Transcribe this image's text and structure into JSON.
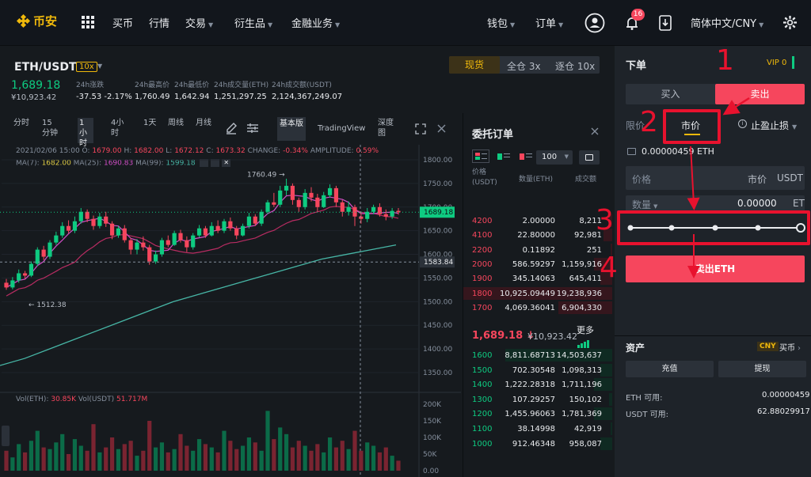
{
  "nav": {
    "brand": "币安",
    "buy": "买币",
    "market": "行情",
    "trade": "交易",
    "derivatives": "衍生品",
    "finance": "金融业务",
    "wallet": "钱包",
    "orders": "订单",
    "notif_count": "16",
    "lang": "简体中文/CNY"
  },
  "ticker": {
    "pair": "ETH/USDT",
    "leverage": "10x",
    "price": "1,689.18",
    "fiat": "¥10,923.42",
    "stats": [
      {
        "label": "24h涨跌",
        "value": "-37.53 -2.17%"
      },
      {
        "label": "24h最高价",
        "value": "1,760.49"
      },
      {
        "label": "24h最低价",
        "value": "1,642.94"
      },
      {
        "label": "24h成交量(ETH)",
        "value": "1,251,297.25"
      },
      {
        "label": "24h成交额(USDT)",
        "value": "2,124,367,249.07"
      }
    ],
    "mode_spot": "现货",
    "mode_cross": "全仓",
    "cross_lev": "3x",
    "mode_iso": "逐仓",
    "iso_lev": "10x"
  },
  "chart": {
    "intervals": [
      "分时",
      "15分钟",
      "1小时",
      "4小时",
      "1天",
      "周线",
      "月线"
    ],
    "basic": "基本版",
    "tv": "TradingView",
    "depth": "深度图",
    "info": "2021/02/06 15:00",
    "o_l": "O:",
    "o": "1679.00",
    "h_l": "H:",
    "h": "1682.00",
    "l_l": "L:",
    "l": "1672.12",
    "c_l": "C:",
    "c": "1673.32",
    "chg_l": "CHANGE:",
    "chg": "-0.34%",
    "amp_l": "AMPLITUDE:",
    "amp": "0.59%",
    "ma7_l": "MA(7):",
    "ma7": "1682.00",
    "ma25_l": "MA(25):",
    "ma25": "1690.83",
    "ma99_l": "MA(99):",
    "ma99": "1599.18",
    "high_mark": "1760.49",
    "low_mark": "1512.38",
    "price_tag": "1689.18",
    "cross_tag": "1583.84",
    "vol_eth_l": "Vol(ETH):",
    "vol_eth": "30.85K",
    "vol_usdt_l": "Vol(USDT)",
    "vol_usdt": "51.717M",
    "yticks": [
      "1800.00",
      "1750.00",
      "1700.00",
      "1650.00",
      "1600.00",
      "1550.00",
      "1500.00",
      "1450.00",
      "1400.00",
      "1350.00"
    ],
    "vticks": [
      "200K",
      "150K",
      "100K",
      "50K",
      "0.00"
    ]
  },
  "chart_data": {
    "type": "candlestick",
    "pair": "ETH/USDT",
    "candles": [
      [
        1540,
        1530,
        1548,
        1525
      ],
      [
        1530,
        1545,
        1552,
        1526
      ],
      [
        1545,
        1560,
        1568,
        1540
      ],
      [
        1560,
        1555,
        1565,
        1548
      ],
      [
        1555,
        1580,
        1585,
        1552
      ],
      [
        1580,
        1610,
        1615,
        1575
      ],
      [
        1610,
        1595,
        1618,
        1588
      ],
      [
        1595,
        1625,
        1630,
        1590
      ],
      [
        1625,
        1640,
        1648,
        1620
      ],
      [
        1640,
        1660,
        1668,
        1635
      ],
      [
        1660,
        1650,
        1672,
        1645
      ],
      [
        1650,
        1670,
        1680,
        1645
      ],
      [
        1670,
        1690,
        1698,
        1665
      ],
      [
        1690,
        1675,
        1695,
        1668
      ],
      [
        1675,
        1660,
        1682,
        1652
      ],
      [
        1660,
        1680,
        1688,
        1655
      ],
      [
        1680,
        1665,
        1690,
        1658
      ],
      [
        1665,
        1640,
        1670,
        1632
      ],
      [
        1640,
        1655,
        1660,
        1635
      ],
      [
        1655,
        1630,
        1662,
        1625
      ],
      [
        1630,
        1610,
        1635,
        1600
      ],
      [
        1610,
        1625,
        1632,
        1600
      ],
      [
        1625,
        1615,
        1638,
        1608
      ],
      [
        1615,
        1585,
        1620,
        1578
      ],
      [
        1585,
        1600,
        1608,
        1580
      ],
      [
        1600,
        1630,
        1635,
        1595
      ],
      [
        1630,
        1620,
        1640,
        1615
      ],
      [
        1620,
        1645,
        1650,
        1618
      ],
      [
        1645,
        1630,
        1652,
        1625
      ],
      [
        1630,
        1615,
        1638,
        1605
      ],
      [
        1615,
        1640,
        1645,
        1610
      ],
      [
        1640,
        1655,
        1662,
        1636
      ],
      [
        1655,
        1640,
        1660,
        1635
      ],
      [
        1640,
        1660,
        1668,
        1638
      ],
      [
        1660,
        1650,
        1672,
        1645
      ],
      [
        1650,
        1670,
        1675,
        1645
      ],
      [
        1670,
        1655,
        1678,
        1650
      ],
      [
        1655,
        1640,
        1660,
        1632
      ],
      [
        1640,
        1660,
        1665,
        1638
      ],
      [
        1660,
        1680,
        1688,
        1655
      ],
      [
        1680,
        1665,
        1685,
        1660
      ],
      [
        1665,
        1690,
        1695,
        1660
      ],
      [
        1690,
        1710,
        1715,
        1685
      ],
      [
        1710,
        1705,
        1730,
        1700
      ],
      [
        1705,
        1735,
        1745,
        1700
      ],
      [
        1735,
        1745,
        1760,
        1725
      ],
      [
        1745,
        1715,
        1750,
        1705
      ],
      [
        1715,
        1700,
        1720,
        1690
      ],
      [
        1700,
        1730,
        1738,
        1695
      ],
      [
        1730,
        1720,
        1742,
        1712
      ],
      [
        1720,
        1700,
        1728,
        1690
      ],
      [
        1700,
        1725,
        1732,
        1698
      ],
      [
        1725,
        1740,
        1748,
        1720
      ],
      [
        1740,
        1710,
        1745,
        1700
      ],
      [
        1710,
        1690,
        1715,
        1680
      ],
      [
        1690,
        1700,
        1712,
        1682
      ],
      [
        1700,
        1680,
        1705,
        1660
      ],
      [
        1680,
        1675,
        1690,
        1665
      ],
      [
        1675,
        1690,
        1698,
        1668
      ],
      [
        1690,
        1700,
        1705,
        1685
      ],
      [
        1700,
        1685,
        1708,
        1680
      ],
      [
        1685,
        1680,
        1695,
        1672
      ],
      [
        1680,
        1692,
        1698,
        1675
      ],
      [
        1692,
        1689,
        1698,
        1684
      ]
    ],
    "ma99": [
      1365,
      1380,
      1400,
      1420,
      1440,
      1460,
      1480,
      1500,
      1515,
      1530,
      1545,
      1560,
      1575,
      1590,
      1600,
      1610,
      1620
    ],
    "volume": [
      60,
      40,
      80,
      55,
      90,
      120,
      70,
      65,
      85,
      110,
      50,
      95,
      75,
      60,
      140,
      55,
      70,
      100,
      65,
      80,
      90,
      45,
      60,
      150,
      70,
      85,
      55,
      65,
      110,
      75,
      60,
      95,
      80,
      70,
      55,
      120,
      90,
      65,
      75,
      100,
      85,
      60,
      180,
      95,
      130,
      110,
      70,
      90,
      75,
      60,
      80,
      55,
      100,
      70,
      90,
      65,
      120,
      60,
      85,
      75,
      55,
      70,
      45,
      30
    ],
    "yrange": [
      1350,
      1800
    ],
    "vrange": [
      0,
      200
    ]
  },
  "orderbook": {
    "title": "委托订单",
    "depth": "100",
    "h_price": "价格(USDT)",
    "h_qty": "数量(ETH)",
    "h_total": "成交额",
    "asks": [
      {
        "p": "4200",
        "q": "2.00000",
        "t": "8,211"
      },
      {
        "p": "4100",
        "q": "22.80000",
        "t": "92,981"
      },
      {
        "p": "2200",
        "q": "0.11892",
        "t": "251"
      },
      {
        "p": "2000",
        "q": "586.59297",
        "t": "1,159,916"
      },
      {
        "p": "1900",
        "q": "345.14063",
        "t": "645,411"
      },
      {
        "p": "1800",
        "q": "10,925.09449",
        "t": "19,238,936"
      },
      {
        "p": "1700",
        "q": "4,069.36041",
        "t": "6,904,330"
      }
    ],
    "last": "1,689.18",
    "arrow": "↓",
    "last_fiat": "¥10,923.42",
    "more": "更多",
    "bids": [
      {
        "p": "1600",
        "q": "8,811.68713",
        "t": "14,503,637"
      },
      {
        "p": "1500",
        "q": "702.30548",
        "t": "1,098,313"
      },
      {
        "p": "1400",
        "q": "1,222.28318",
        "t": "1,711,196"
      },
      {
        "p": "1300",
        "q": "107.29257",
        "t": "150,102"
      },
      {
        "p": "1200",
        "q": "1,455.96063",
        "t": "1,781,369"
      },
      {
        "p": "1100",
        "q": "38.14998",
        "t": "42,919"
      },
      {
        "p": "1000",
        "q": "912.46348",
        "t": "958,087"
      }
    ],
    "ask_fill": [
      0.02,
      0.06,
      0.01,
      0.12,
      0.08,
      1.0,
      0.36
    ],
    "bid_fill": [
      0.72,
      0.08,
      0.12,
      0.02,
      0.12,
      0.01,
      0.08
    ]
  },
  "trade": {
    "title": "下单",
    "vip": "VIP 0",
    "buy_tab": "买入",
    "sell_tab": "卖出",
    "limit": "限价",
    "market": "市价",
    "stop": "止盈止损",
    "avail": "0.00000459 ETH",
    "price_l": "价格",
    "price_v": "市价",
    "price_u": "USDT",
    "qty_l": "数量",
    "qty_v": "0.00000",
    "qty_u": "ETH",
    "sell_btn": "卖出ETH",
    "assets": "资产",
    "cny": "CNY",
    "buy_coin": "买币",
    "deposit": "充值",
    "withdraw": "提现",
    "eth_avail_l": "ETH 可用:",
    "eth_avail": "0.00000459",
    "usdt_avail_l": "USDT 可用:",
    "usdt_avail": "62.88029917"
  },
  "annotations": [
    "1",
    "2",
    "3",
    "4"
  ]
}
